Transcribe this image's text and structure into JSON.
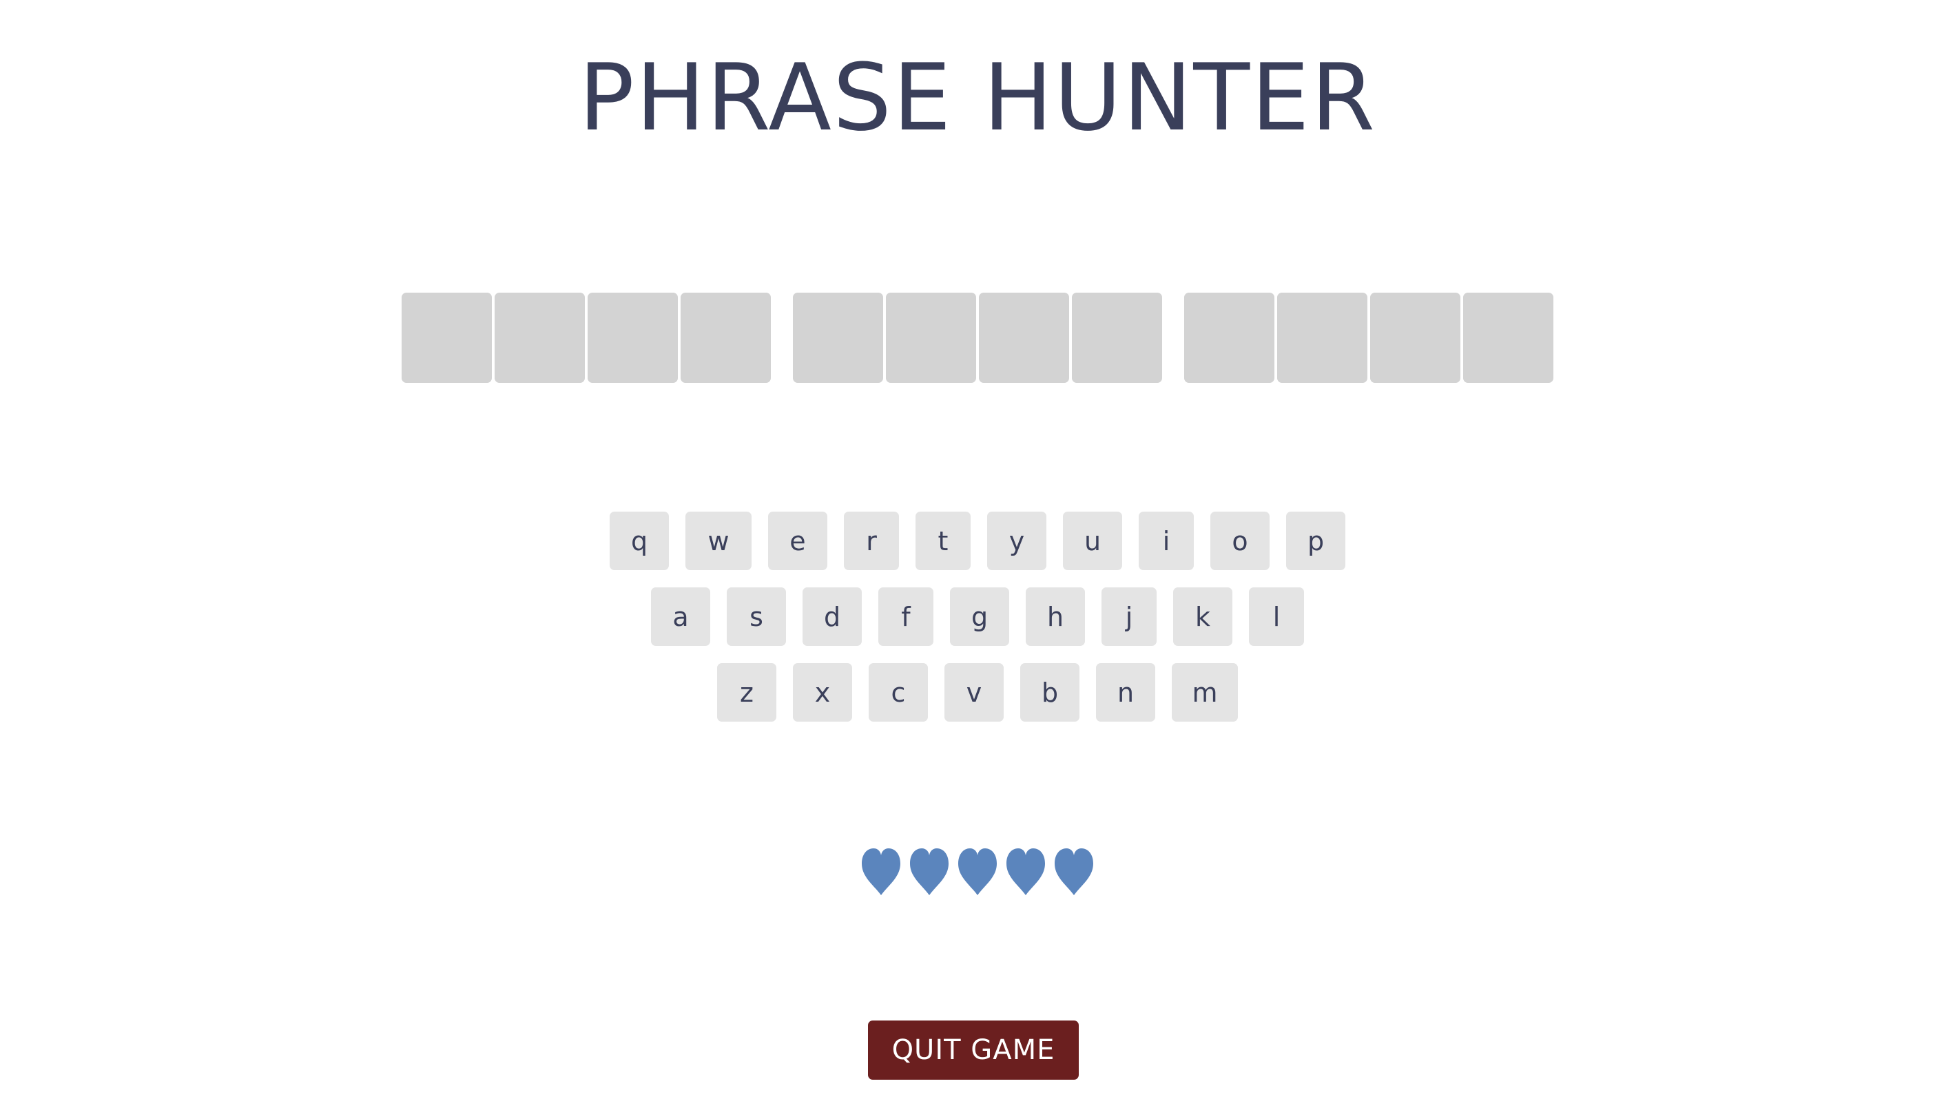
{
  "title": "PHRASE HUNTER",
  "phrase": {
    "words": [
      {
        "letters": [
          "",
          "",
          "",
          ""
        ]
      },
      {
        "letters": [
          "",
          "",
          "",
          ""
        ]
      },
      {
        "letters": [
          "",
          "",
          "",
          ""
        ]
      }
    ]
  },
  "keyboard": {
    "rows": [
      [
        "q",
        "w",
        "e",
        "r",
        "t",
        "y",
        "u",
        "i",
        "o",
        "p"
      ],
      [
        "a",
        "s",
        "d",
        "f",
        "g",
        "h",
        "j",
        "k",
        "l"
      ],
      [
        "z",
        "x",
        "c",
        "v",
        "b",
        "n",
        "m"
      ]
    ]
  },
  "lives": {
    "remaining": 5,
    "total": 5,
    "icon": "heart-icon",
    "color": "#5b85bd"
  },
  "quit_button": {
    "label": "QUIT GAME",
    "color": "#6b1f1f"
  },
  "colors": {
    "title": "#3a3f5a",
    "tile": "#d3d3d3",
    "key": "#e4e4e4"
  }
}
